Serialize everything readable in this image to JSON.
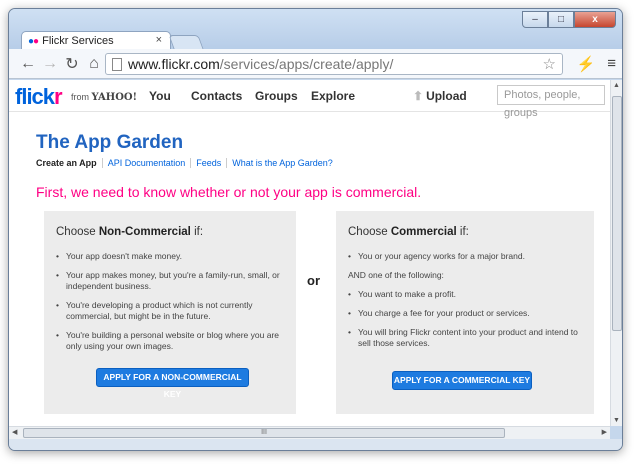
{
  "browser": {
    "tab_title": "Flickr Services",
    "tab_close": "×",
    "url_host": "www.flickr.com",
    "url_path": "/services/apps/create/apply/",
    "window_buttons": {
      "minimize": "–",
      "maximize": "□",
      "close": "x"
    }
  },
  "flickr_header": {
    "logo_flick": "flick",
    "logo_r": "r",
    "from_label": "from",
    "yahoo": "YAHOO!",
    "nav": [
      "You",
      "Contacts",
      "Groups",
      "Explore"
    ],
    "upload": "Upload",
    "search_placeholder": "Photos, people, groups"
  },
  "page": {
    "title": "The App Garden",
    "subnav": {
      "current": "Create an App",
      "links": [
        "API Documentation",
        "Feeds",
        "What is the App Garden?"
      ]
    },
    "intro": "First, we need to know whether or not your app is commercial.",
    "or": "or",
    "non_commercial": {
      "heading_prefix": "Choose ",
      "heading_bold": "Non-Commercial",
      "heading_suffix": " if:",
      "bullets": [
        "Your app doesn't make money.",
        "Your app makes money, but you're a family-run, small, or independent business.",
        "You're developing a product which is not currently commercial, but might be in the future.",
        "You're building a personal website or blog where you are only using your own images."
      ],
      "button": "APPLY FOR A NON-COMMERCIAL KEY"
    },
    "commercial": {
      "heading_prefix": "Choose ",
      "heading_bold": "Commercial",
      "heading_suffix": " if:",
      "first_bullet": "You or your agency works for a major brand.",
      "and_line": "AND one of the following:",
      "bullets": [
        "You want to make a profit.",
        "You charge a fee for your product or services.",
        "You will bring Flickr content into your product and intend to sell those services."
      ],
      "button": "APPLY FOR A COMMERCIAL KEY"
    }
  },
  "scrollbar": {
    "grip": "III"
  }
}
